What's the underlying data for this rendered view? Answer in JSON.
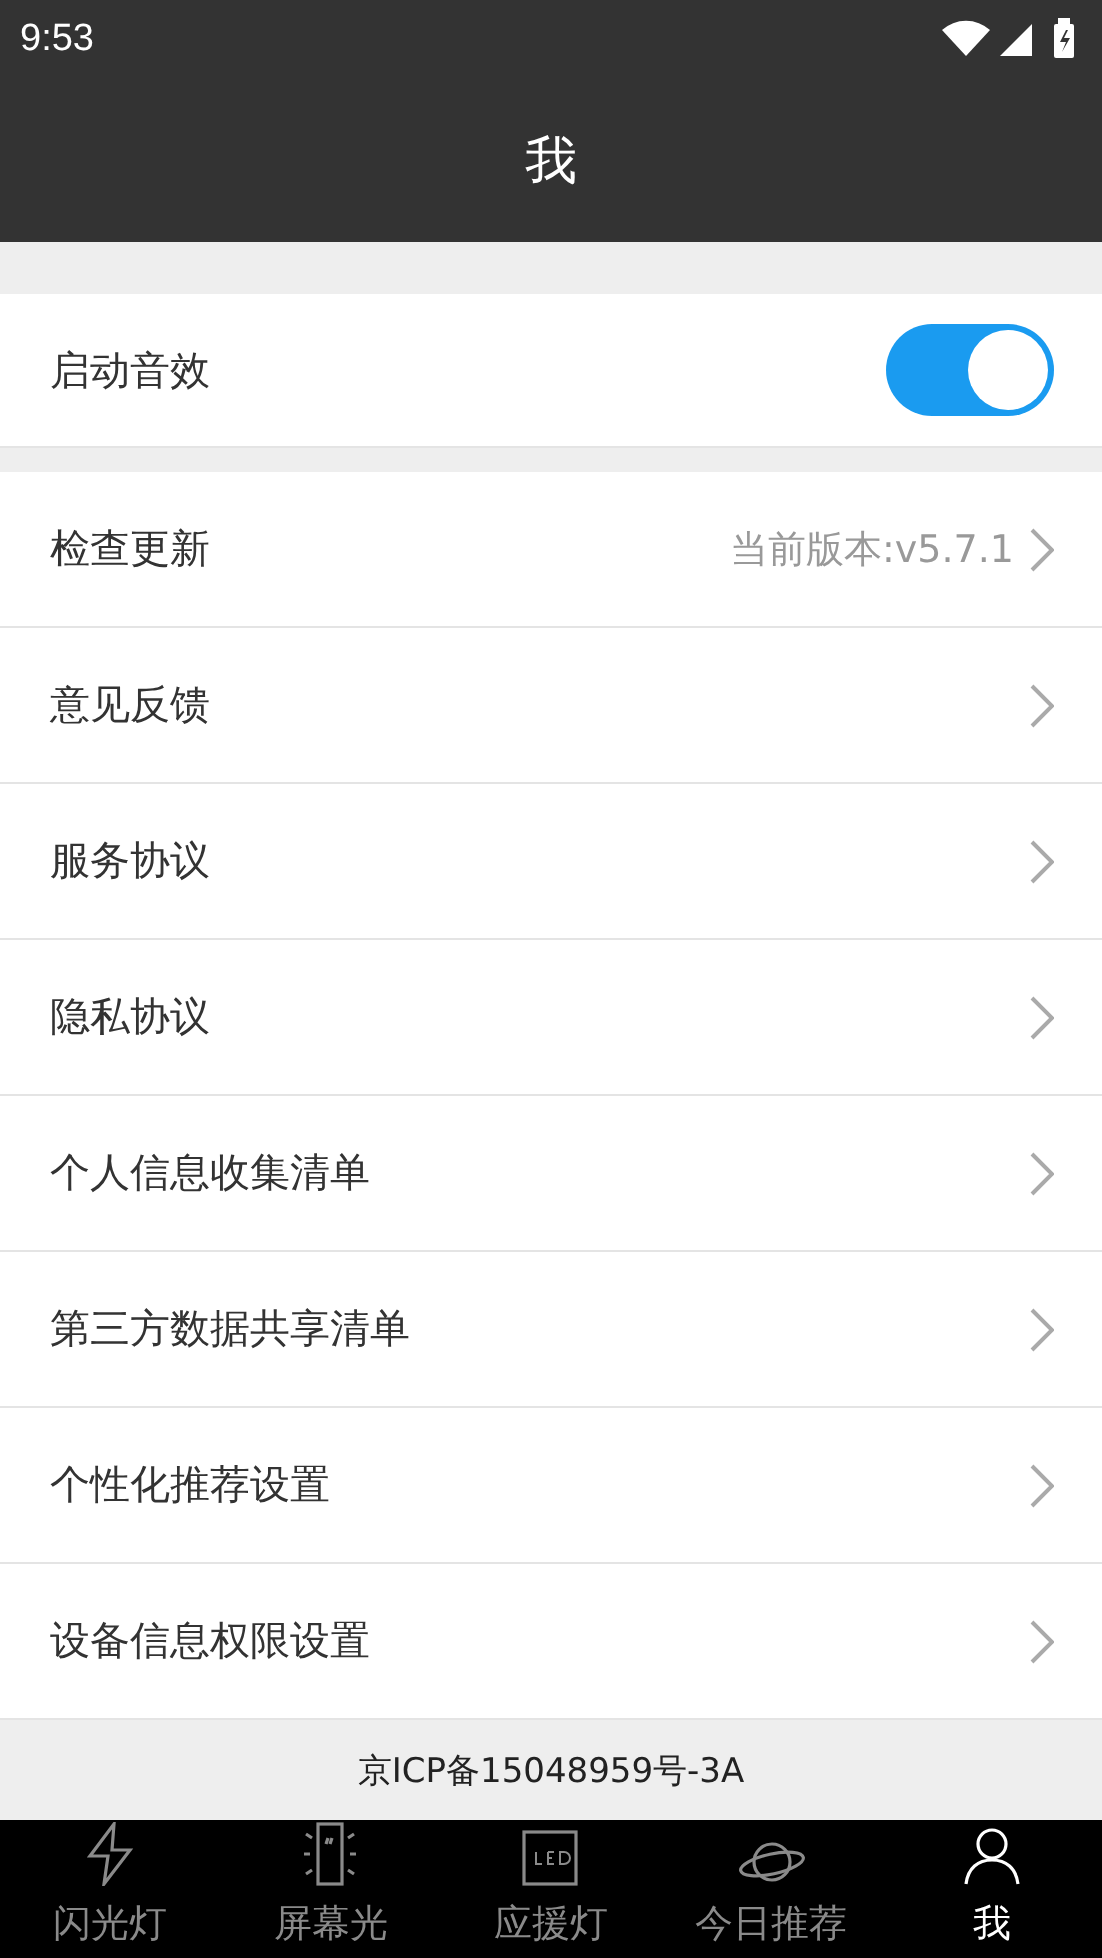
{
  "status_bar": {
    "time": "9:53"
  },
  "header": {
    "title": "我"
  },
  "sound_setting": {
    "label": "启动音效",
    "on": true
  },
  "menu_items": [
    {
      "label": "检查更新",
      "value": "当前版本:v5.7.1"
    },
    {
      "label": "意见反馈"
    },
    {
      "label": "服务协议"
    },
    {
      "label": "隐私协议"
    },
    {
      "label": "个人信息收集清单"
    },
    {
      "label": "第三方数据共享清单"
    },
    {
      "label": "个性化推荐设置"
    },
    {
      "label": "设备信息权限设置"
    }
  ],
  "footer": {
    "text": "京ICP备15048959号-3A"
  },
  "tabs": [
    {
      "label": "闪光灯",
      "kind": "bolt",
      "selected": false
    },
    {
      "label": "屏幕光",
      "kind": "phone",
      "selected": false
    },
    {
      "label": "应援灯",
      "kind": "led",
      "selected": false
    },
    {
      "label": "今日推荐",
      "kind": "planet",
      "selected": false
    },
    {
      "label": "我",
      "kind": "person",
      "selected": true
    }
  ]
}
